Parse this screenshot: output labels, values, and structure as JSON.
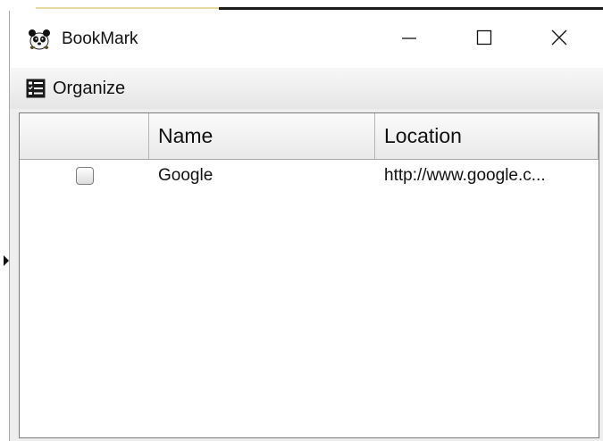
{
  "window": {
    "title": "BookMark",
    "app_icon": "panda-icon",
    "controls": {
      "minimize_icon": "minimize-icon",
      "maximize_icon": "maximize-icon",
      "close_icon": "close-icon"
    }
  },
  "menubar": {
    "items": [
      {
        "label": "Organize",
        "icon": "checklist-icon"
      }
    ]
  },
  "table": {
    "columns": [
      "",
      "Name",
      "Location"
    ],
    "rows": [
      {
        "checked": false,
        "name": "Google",
        "location": "http://www.google.c..."
      }
    ]
  }
}
